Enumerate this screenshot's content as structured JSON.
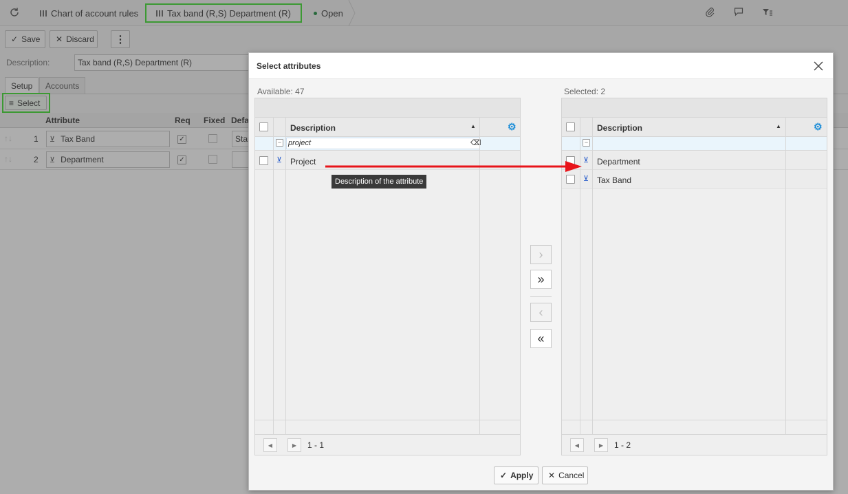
{
  "topbar": {
    "breadcrumb_1": "Chart of account rules",
    "breadcrumb_2": "Tax band (R,S) Department (R)",
    "status": "Open"
  },
  "toolbar": {
    "save_label": "Save",
    "discard_label": "Discard",
    "more_label": "⋮"
  },
  "form": {
    "description_label": "Description:",
    "description_value": "Tax band (R,S) Department (R)"
  },
  "tabs": [
    "Setup",
    "Accounts"
  ],
  "select_button_label": "Select",
  "grid": {
    "headers": [
      "Attribute",
      "Req",
      "Fixed",
      "Defa"
    ],
    "rows": [
      {
        "num": "1",
        "attribute": "Tax Band",
        "default": "Stan"
      },
      {
        "num": "2",
        "attribute": "Department",
        "default": ""
      }
    ]
  },
  "dialog": {
    "title": "Select attributes",
    "available_label": "Available: 47",
    "selected_label": "Selected: 2",
    "column_header": "Description",
    "filter_value": "project",
    "tooltip": "Description of the attribute",
    "available_rows": [
      "Project"
    ],
    "selected_rows": [
      "Department",
      "Tax Band"
    ],
    "available_pager": "1 - 1",
    "selected_pager": "1 - 2",
    "apply_label": "Apply",
    "cancel_label": "Cancel"
  },
  "colors": {
    "highlight_green": "#3ddc2d",
    "annotation_arrow": "#e8141a",
    "gear_blue": "#1e8ed8"
  }
}
